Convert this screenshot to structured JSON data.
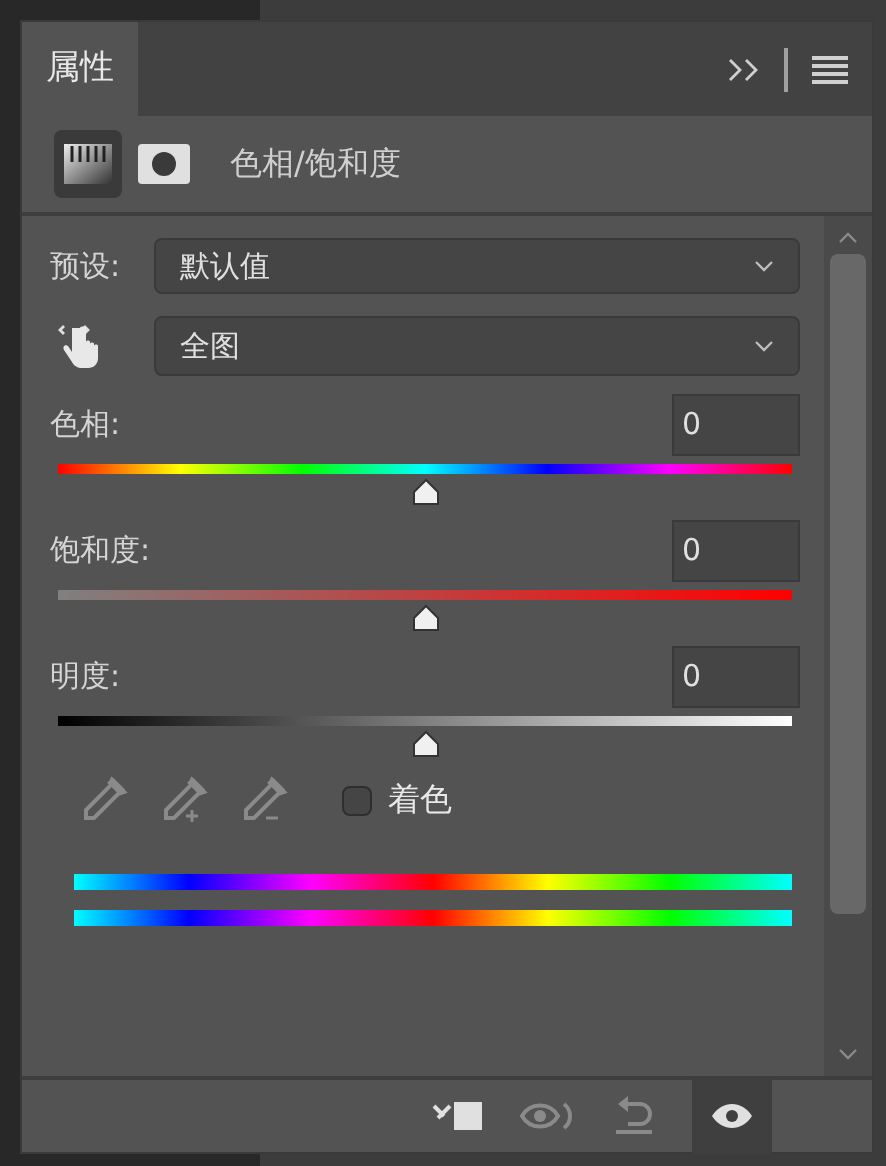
{
  "tab": {
    "label": "属性",
    "selected": true
  },
  "adjustment": {
    "title": "色相/饱和度"
  },
  "preset": {
    "label": "预设:",
    "value": "默认值"
  },
  "channel": {
    "value": "全图"
  },
  "sliders": [
    {
      "kind": "hue",
      "label": "色相:",
      "value": "0",
      "level": 0.5
    },
    {
      "kind": "saturation",
      "label": "饱和度:",
      "value": "0",
      "level": 0.5
    },
    {
      "kind": "lightness",
      "label": "明度:",
      "value": "0",
      "level": 0.5
    }
  ],
  "colorize": {
    "label": "着色",
    "checked": false
  }
}
